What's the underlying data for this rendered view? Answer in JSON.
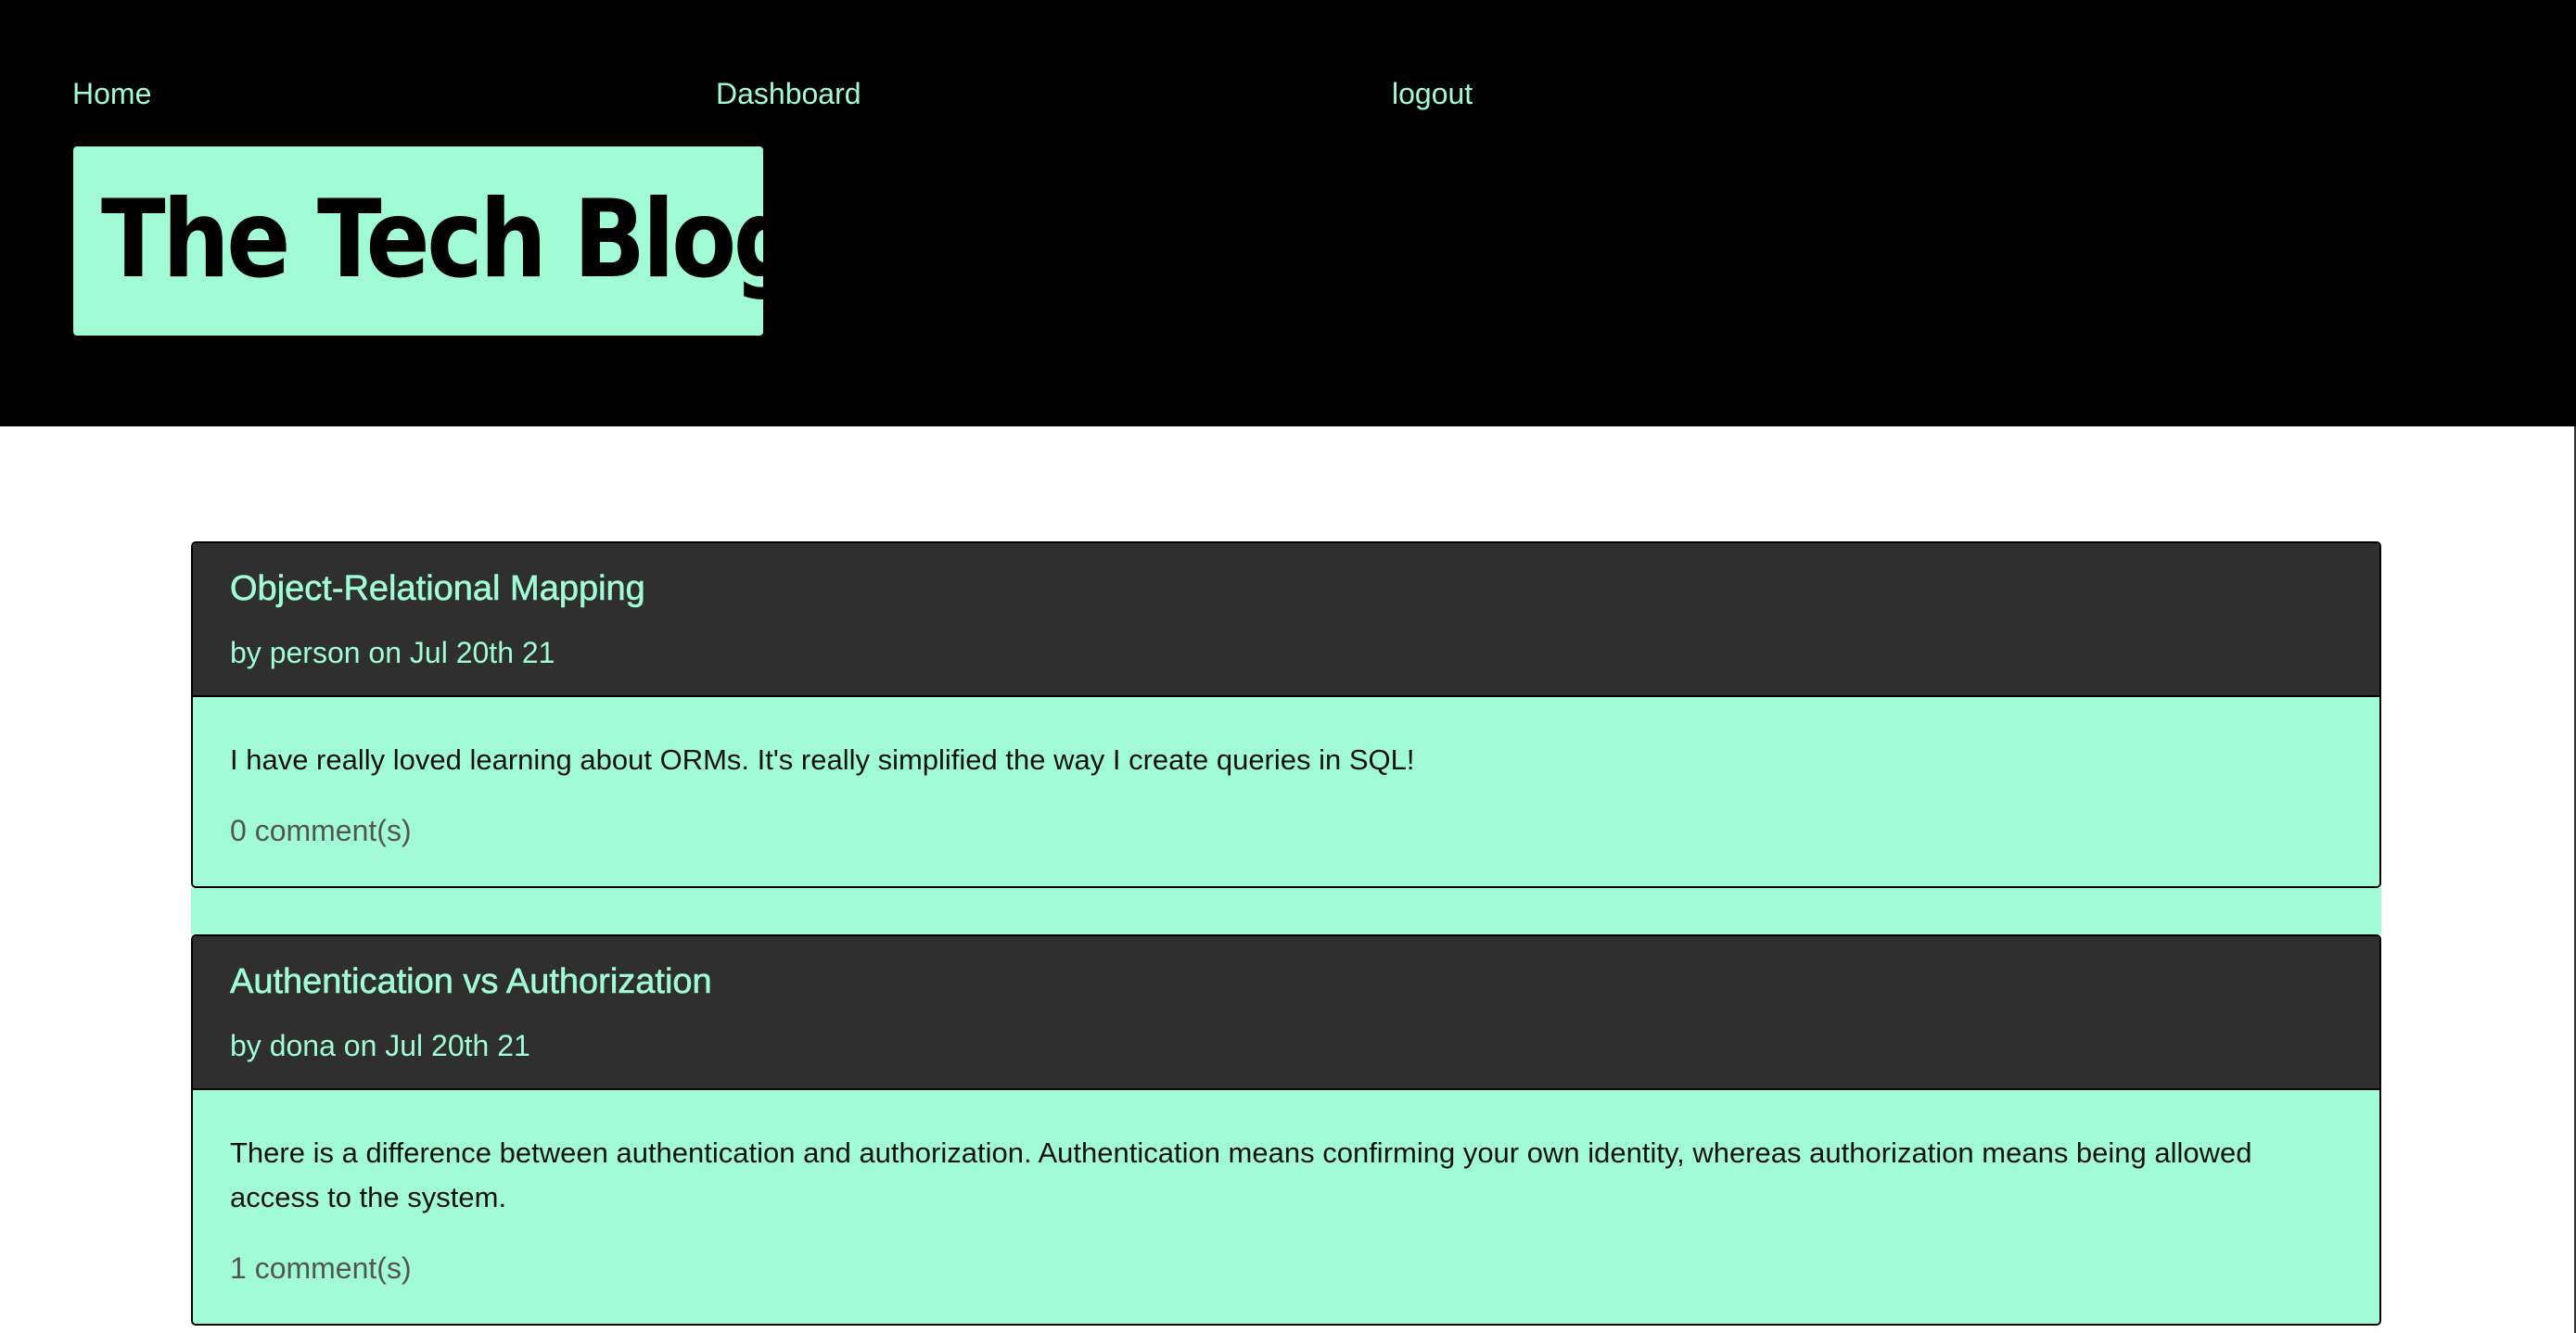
{
  "nav": {
    "home": "Home",
    "dashboard": "Dashboard",
    "logout": "logout"
  },
  "brand": {
    "title": "The Tech Blog"
  },
  "posts": [
    {
      "title": "Object-Relational Mapping",
      "meta": "by person on Jul 20th 21",
      "body": "I have really loved learning about ORMs. It's really simplified the way I create queries in SQL!",
      "comments": "0 comment(s)"
    },
    {
      "title": "Authentication vs Authorization",
      "meta": "by dona on Jul 20th 21",
      "body": "There is a difference between authentication and authorization. Authentication means confirming your own identity, whereas authorization means being allowed access to the system.",
      "comments": "1 comment(s)"
    }
  ],
  "colors": {
    "accent": "#a1fcd6",
    "header_bg": "#000000",
    "card_header_bg": "#2f2f2f"
  }
}
